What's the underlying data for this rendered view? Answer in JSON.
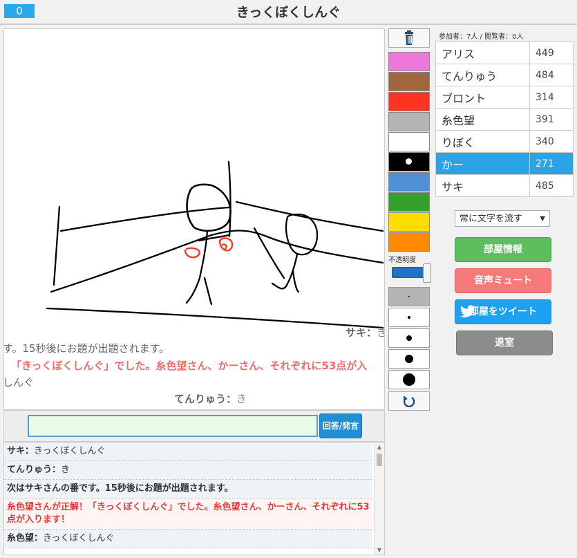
{
  "header": {
    "counter": "0",
    "title": "きっくぼくしんぐ"
  },
  "canvas": {
    "flow_1": {
      "name": "サキ：",
      "text": "き"
    },
    "flow_2": "す。15秒後にお題が出題されます。",
    "flow_3": "「きっくぼくしんぐ」でした。糸色望さん、かーさん、それぞれに53点が入",
    "flow_4": "しんぐ",
    "flow_5": {
      "name": "てんりゅう：",
      "text": "き"
    }
  },
  "chat": {
    "input_value": "",
    "submit_label": "回答/発言",
    "log": [
      {
        "name": "サキ：",
        "text": "きっくぼくしんぐ"
      },
      {
        "name": "てんりゅう：",
        "text": "き"
      },
      {
        "name": "",
        "text": "次はサキさんの番です。15秒後にお題が出題されます。"
      },
      {
        "name": "",
        "text": "糸色望さんが正解！「きっくぼくしんぐ」でした。糸色望さん、かーさん、それぞれに53点が入ります！",
        "red": true
      },
      {
        "name": "糸色望：",
        "text": "きっくぼくしんぐ"
      }
    ]
  },
  "tools": {
    "colors": [
      "#ee77dd",
      "#a0663c",
      "#ff3322",
      "#b4b4b4",
      "#ffffff",
      "#000000",
      "#4f8fd6",
      "#33a02c",
      "#ffdd00",
      "#ff8800"
    ],
    "selected_color": "#000000",
    "opacity_label": "不透明度",
    "opacity": 1.0,
    "trash_icon": "trash-icon",
    "undo_icon": "undo-icon"
  },
  "players": {
    "counts_label": "参加者：7人 / 閲覧者：0人",
    "list": [
      {
        "name": "アリス",
        "score": "449"
      },
      {
        "name": "てんりゅう",
        "score": "484"
      },
      {
        "name": "ブロント",
        "score": "314"
      },
      {
        "name": "糸色望",
        "score": "391"
      },
      {
        "name": "りぼく",
        "score": "340"
      },
      {
        "name": "かー",
        "score": "271",
        "active": true
      },
      {
        "name": "サキ",
        "score": "485"
      }
    ]
  },
  "controls": {
    "flow_select": "常に文字を流す",
    "room_info": "部屋情報",
    "mute": "音声ミュート",
    "tweet": "部屋をツイート",
    "leave": "退室"
  }
}
